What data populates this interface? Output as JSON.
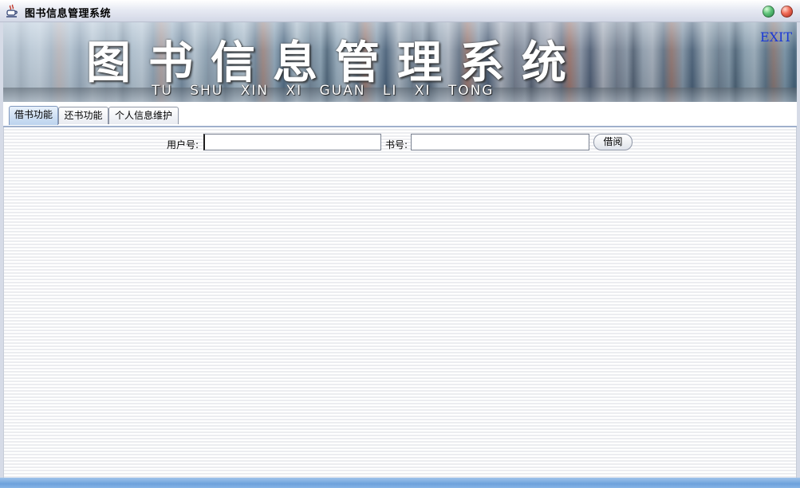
{
  "window": {
    "title": "图书信息管理系统",
    "icon": "java-cup-icon",
    "controls": [
      "minimize-icon",
      "close-icon"
    ]
  },
  "banner": {
    "title": "图书信息管理系统",
    "pinyin": "TU SHU XIN XI GUAN LI XI TONG",
    "exit_label": "EXIT"
  },
  "tabs": [
    {
      "label": "借书功能",
      "active": true
    },
    {
      "label": "还书功能",
      "active": false
    },
    {
      "label": "个人信息维护",
      "active": false
    }
  ],
  "borrow_form": {
    "user_label": "用户号:",
    "user_value": "",
    "book_label": "书号:",
    "book_value": "",
    "submit_label": "借阅"
  },
  "colors": {
    "exit_link": "#1a38d6",
    "active_tab": "#bcd3ee",
    "bottom_bar": "#6ea2dc"
  }
}
